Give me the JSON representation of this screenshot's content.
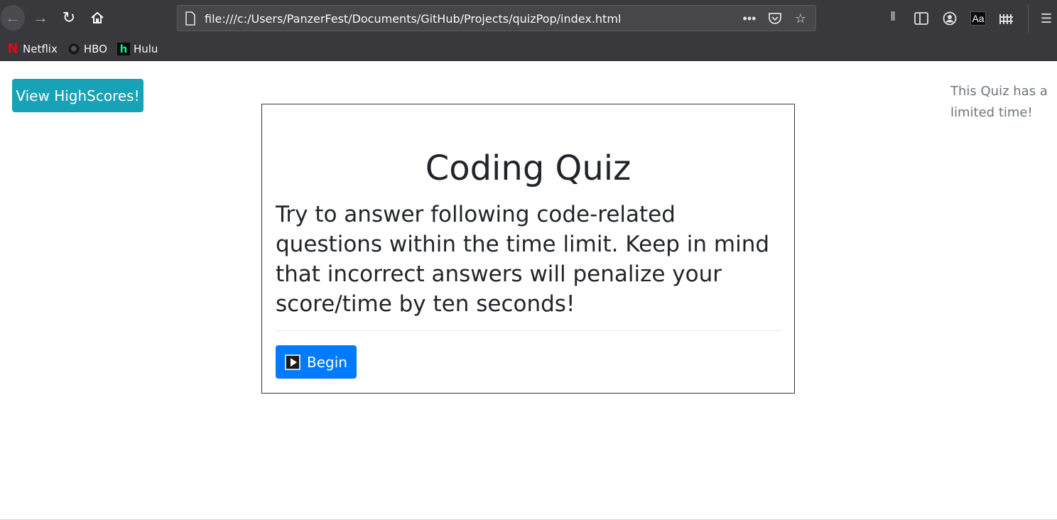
{
  "browser": {
    "url": "file:///c:/Users/PanzerFest/Documents/GitHub/Projects/quizPop/index.html",
    "aa_label": "Aa",
    "bookmarks": [
      {
        "label": "Netflix",
        "icon": "netflix-icon",
        "glyph": "N"
      },
      {
        "label": "HBO",
        "icon": "hbo-icon",
        "glyph": "●"
      },
      {
        "label": "Hulu",
        "icon": "hulu-icon",
        "glyph": "h"
      }
    ]
  },
  "page": {
    "highscores_label": "View HighScores!",
    "timer_note": "This Quiz has a limited time!",
    "quiz": {
      "title": "Coding Quiz",
      "description": "Try to answer following code-related questions within the time limit. Keep in mind that incorrect answers will penalize your score/time by ten seconds!",
      "begin_label": "Begin"
    }
  },
  "colors": {
    "chrome": "#38383d",
    "info_button": "#17a2b8",
    "primary_button": "#007bff",
    "muted_text": "#6c757d"
  }
}
